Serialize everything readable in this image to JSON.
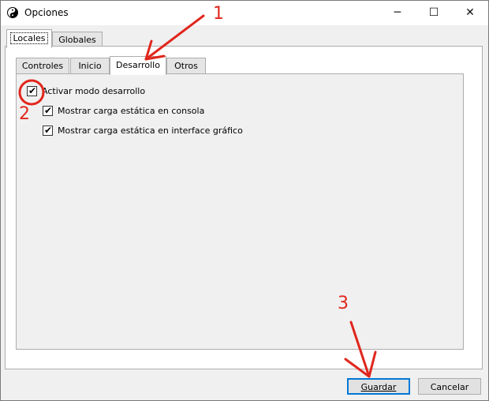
{
  "window": {
    "title": "Opciones",
    "controls": {
      "minimize": "─",
      "maximize": "☐",
      "close": "✕"
    }
  },
  "outer_tabs": [
    {
      "label": "Locales",
      "active": true
    },
    {
      "label": "Globales",
      "active": false
    }
  ],
  "inner_tabs": [
    {
      "label": "Controles",
      "active": false
    },
    {
      "label": "Inicio",
      "active": false
    },
    {
      "label": "Desarrollo",
      "active": true
    },
    {
      "label": "Otros",
      "active": false
    }
  ],
  "options": [
    {
      "label": "Activar modo desarrollo",
      "checked": true
    },
    {
      "label": "Mostrar carga estática en consola",
      "checked": true
    },
    {
      "label": "Mostrar carga estática en interface gráfico",
      "checked": true
    }
  ],
  "buttons": {
    "save": "Guardar",
    "cancel": "Cancelar"
  },
  "annotations": {
    "step1": "1",
    "step2": "2",
    "step3": "3"
  },
  "colors": {
    "annotation_red": "#e1261c",
    "focus_blue": "#0078d7"
  },
  "icons": {
    "app": "yin-yang-icon",
    "check": "check-icon"
  }
}
